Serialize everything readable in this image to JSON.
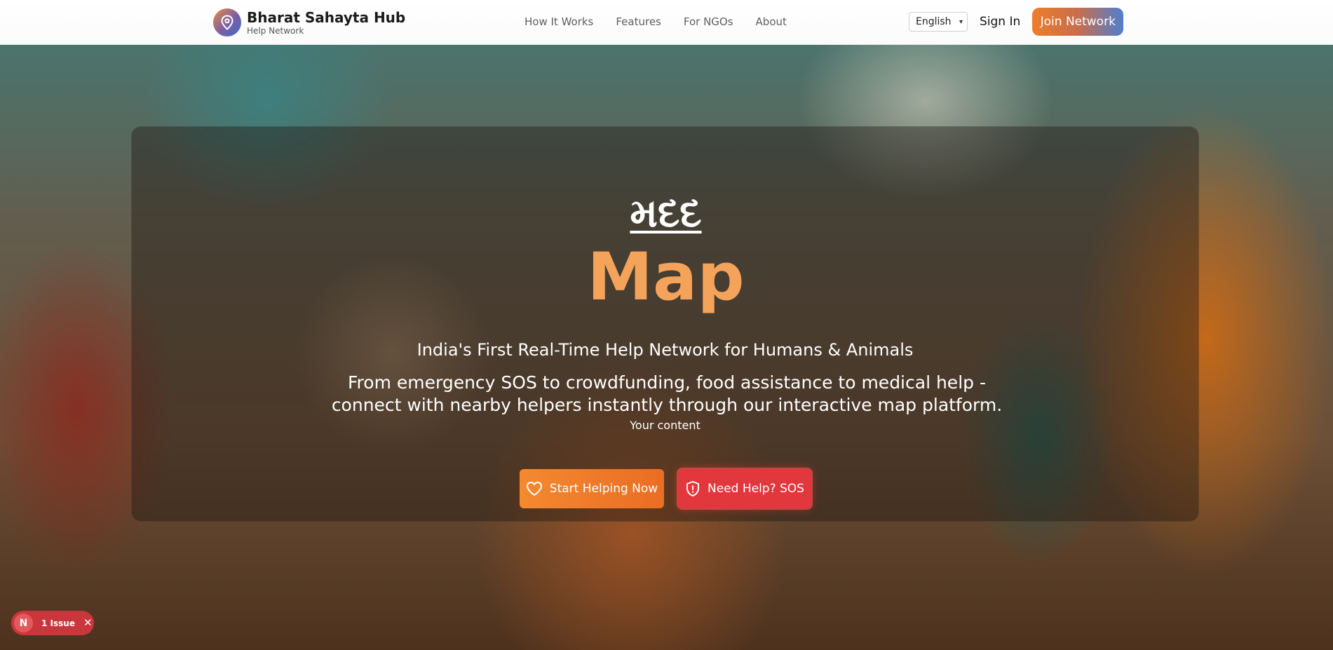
{
  "brand": {
    "name": "Bharat Sahayta Hub",
    "tagline": "Help Network",
    "logo_icon": "map-pin-icon"
  },
  "nav": {
    "links": [
      "How It Works",
      "Features",
      "For NGOs",
      "About"
    ],
    "language": "English",
    "sign_in": "Sign In",
    "join": "Join Network"
  },
  "hero": {
    "script_title": "મદદ",
    "title": "Map",
    "tagline": "India's First Real-Time Help Network for Humans & Animals",
    "description": "From emergency SOS to crowdfunding, food assistance to medical help - connect with nearby helpers instantly through our interactive map platform.",
    "content_note": "Your content",
    "primary_cta": "Start Helping Now",
    "primary_cta_icon": "heart-icon",
    "secondary_cta": "Need Help? SOS",
    "secondary_cta_icon": "shield-alert-icon"
  },
  "issue_badge": {
    "logo": "N",
    "label": "1 Issue",
    "close_icon": "close-icon"
  },
  "colors": {
    "accent_orange": "#f4a35a",
    "primary_button": "#ea6d24",
    "sos_button": "#e2373d",
    "issue_badge": "#c9373d"
  }
}
